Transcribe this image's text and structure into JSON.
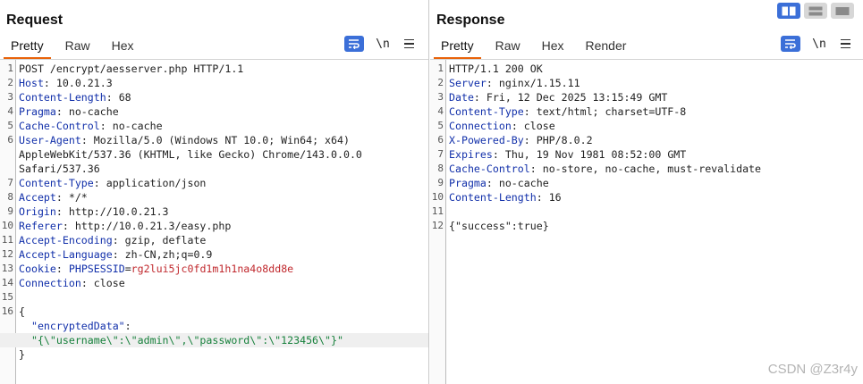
{
  "request": {
    "title": "Request",
    "tabs": [
      {
        "label": "Pretty"
      },
      {
        "label": "Raw"
      },
      {
        "label": "Hex"
      }
    ],
    "toolbar": {
      "newline_label": "\\n"
    },
    "lines": [
      {
        "num": "1",
        "text": "POST /encrypt/aesserver.php HTTP/1.1"
      },
      {
        "num": "2",
        "name": "Host",
        "value": ": 10.0.21.3"
      },
      {
        "num": "3",
        "name": "Content-Length",
        "value": ": 68"
      },
      {
        "num": "4",
        "name": "Pragma",
        "value": ": no-cache"
      },
      {
        "num": "5",
        "name": "Cache-Control",
        "value": ": no-cache"
      },
      {
        "num": "6",
        "name": "User-Agent",
        "value": ": Mozilla/5.0 (Windows NT 10.0; Win64; x64)"
      },
      {
        "num": "",
        "text": "AppleWebKit/537.36 (KHTML, like Gecko) Chrome/143.0.0.0"
      },
      {
        "num": "",
        "text": "Safari/537.36"
      },
      {
        "num": "7",
        "name": "Content-Type",
        "value": ": application/json"
      },
      {
        "num": "8",
        "name": "Accept",
        "value": ": */*"
      },
      {
        "num": "9",
        "name": "Origin",
        "value": ": http://10.0.21.3"
      },
      {
        "num": "10",
        "name": "Referer",
        "value": ": http://10.0.21.3/easy.php"
      },
      {
        "num": "11",
        "name": "Accept-Encoding",
        "value": ": gzip, deflate"
      },
      {
        "num": "12",
        "name": "Accept-Language",
        "value": ": zh-CN,zh;q=0.9"
      },
      {
        "num": "13",
        "name": "Cookie",
        "value": ": ",
        "cookie_name": "PHPSESSID",
        "cookie_eq": "=",
        "cookie_value": "rg2lui5jc0fd1m1h1na4o8dd8e"
      },
      {
        "num": "14",
        "name": "Connection",
        "value": ": close"
      },
      {
        "num": "15",
        "text": ""
      },
      {
        "num": "16",
        "text": "{"
      },
      {
        "num": "",
        "json_key": "  \"encryptedData\"",
        "text_after": ":"
      },
      {
        "num": "",
        "json_str": "  \"{\\\"username\\\":\\\"admin\\\",\\\"password\\\":\\\"123456\\\"}\"",
        "highlight": true
      },
      {
        "num": "",
        "text": "}"
      }
    ]
  },
  "response": {
    "title": "Response",
    "tabs": [
      {
        "label": "Pretty"
      },
      {
        "label": "Raw"
      },
      {
        "label": "Hex"
      },
      {
        "label": "Render"
      }
    ],
    "toolbar": {
      "newline_label": "\\n"
    },
    "lines": [
      {
        "num": "1",
        "text": "HTTP/1.1 200 OK"
      },
      {
        "num": "2",
        "name": "Server",
        "value": ": nginx/1.15.11"
      },
      {
        "num": "3",
        "name": "Date",
        "value": ": Fri, 12 Dec 2025 13:15:49 GMT"
      },
      {
        "num": "4",
        "name": "Content-Type",
        "value": ": text/html; charset=UTF-8"
      },
      {
        "num": "5",
        "name": "Connection",
        "value": ": close"
      },
      {
        "num": "6",
        "name": "X-Powered-By",
        "value": ": PHP/8.0.2"
      },
      {
        "num": "7",
        "name": "Expires",
        "value": ": Thu, 19 Nov 1981 08:52:00 GMT"
      },
      {
        "num": "8",
        "name": "Cache-Control",
        "value": ": no-store, no-cache, must-revalidate"
      },
      {
        "num": "9",
        "name": "Pragma",
        "value": ": no-cache"
      },
      {
        "num": "10",
        "name": "Content-Length",
        "value": ": 16"
      },
      {
        "num": "11",
        "text": ""
      },
      {
        "num": "12",
        "text": "{\"success\":true}"
      }
    ]
  },
  "watermark": "CSDN @Z3r4y",
  "colors": {
    "accent": "#e8630a",
    "toolbar_blue": "#3b6fd8",
    "header_name": "#1230aa",
    "cookie_value": "#c0282d",
    "json_string": "#16803b"
  }
}
